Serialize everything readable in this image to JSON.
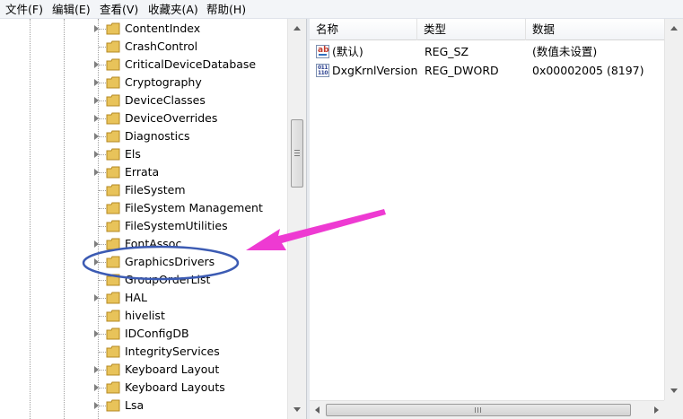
{
  "menu": [
    "文件(F)",
    "编辑(E)",
    "查看(V)",
    "收藏夹(A)",
    "帮助(H)"
  ],
  "tree": {
    "items": [
      {
        "label": "ContentIndex",
        "expandable": true
      },
      {
        "label": "CrashControl",
        "expandable": false
      },
      {
        "label": "CriticalDeviceDatabase",
        "expandable": true
      },
      {
        "label": "Cryptography",
        "expandable": true
      },
      {
        "label": "DeviceClasses",
        "expandable": true
      },
      {
        "label": "DeviceOverrides",
        "expandable": true
      },
      {
        "label": "Diagnostics",
        "expandable": true
      },
      {
        "label": "Els",
        "expandable": true
      },
      {
        "label": "Errata",
        "expandable": true
      },
      {
        "label": "FileSystem",
        "expandable": false
      },
      {
        "label": "FileSystem Management",
        "expandable": false
      },
      {
        "label": "FileSystemUtilities",
        "expandable": false
      },
      {
        "label": "FontAssoc",
        "expandable": true
      },
      {
        "label": "GraphicsDrivers",
        "expandable": true
      },
      {
        "label": "GroupOrderList",
        "expandable": false
      },
      {
        "label": "HAL",
        "expandable": true
      },
      {
        "label": "hivelist",
        "expandable": false
      },
      {
        "label": "IDConfigDB",
        "expandable": true
      },
      {
        "label": "IntegrityServices",
        "expandable": false
      },
      {
        "label": "Keyboard Layout",
        "expandable": true
      },
      {
        "label": "Keyboard Layouts",
        "expandable": true
      },
      {
        "label": "Lsa",
        "expandable": true
      }
    ],
    "highlighted": "GraphicsDrivers"
  },
  "list": {
    "columns": [
      "名称",
      "类型",
      "数据"
    ],
    "rows": [
      {
        "icon": "string-value-icon",
        "name": "(默认)",
        "type": "REG_SZ",
        "data": "(数值未设置)"
      },
      {
        "icon": "binary-value-icon",
        "name": "DxgKrnlVersion",
        "type": "REG_DWORD",
        "data": "0x00002005 (8197)"
      }
    ]
  },
  "icons": {
    "folder": "folder-icon",
    "expander": "expand-arrow-icon",
    "string": "string-value-icon",
    "binary": "binary-value-icon"
  },
  "colors": {
    "highlight_ellipse": "#3c5bb3",
    "arrow": "#ee3ad2",
    "folder": "#e8c35a"
  }
}
